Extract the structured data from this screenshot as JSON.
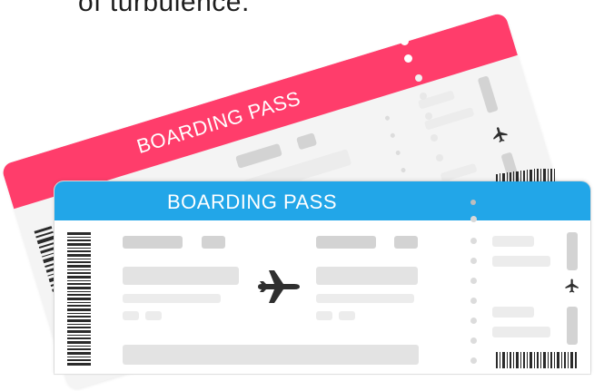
{
  "caption": {
    "text": "of turbulence."
  },
  "back_ticket": {
    "title": "BOARDING PASS",
    "header_color": "#ff3d6b",
    "plane_icon": "airplane-icon"
  },
  "front_ticket": {
    "title": "BOARDING PASS",
    "header_color": "#22a6e8",
    "main_plane_icon": "airplane-icon",
    "stub_plane_icon": "airplane-icon"
  }
}
